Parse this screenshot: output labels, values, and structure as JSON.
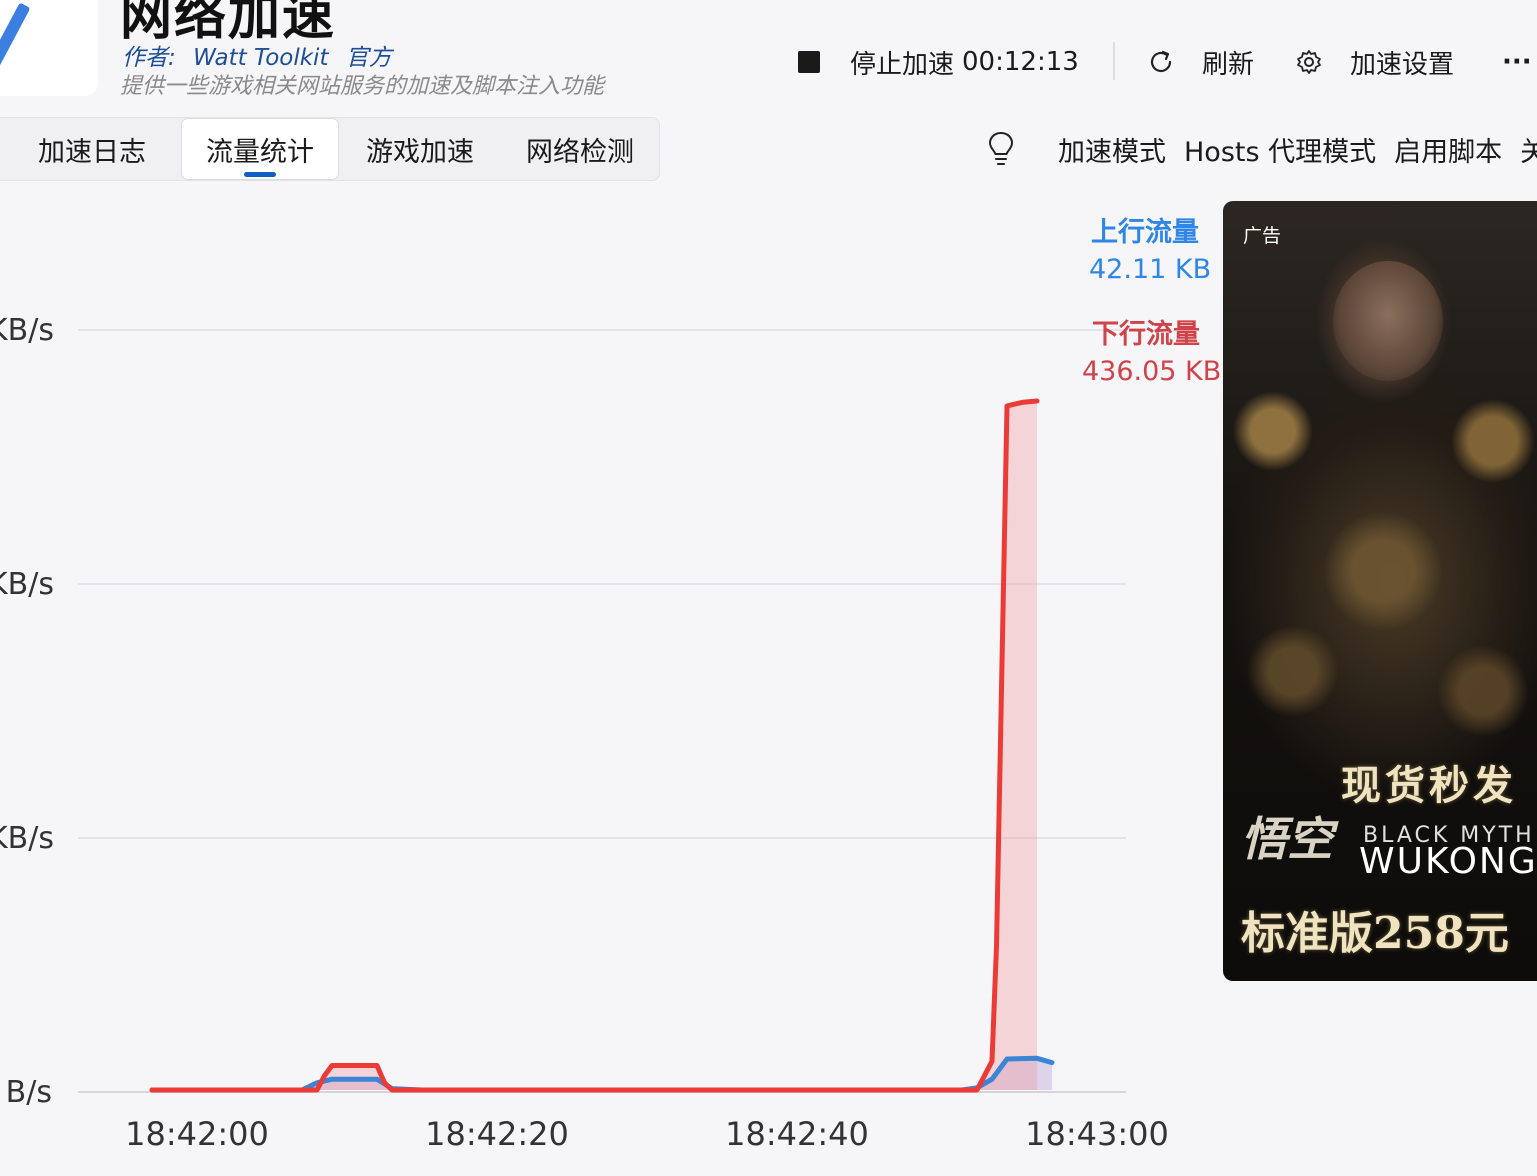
{
  "header": {
    "title": "网络加速",
    "author_label": "作者:",
    "author_name": "Watt Toolkit",
    "author_tag": "官方",
    "description": "提供一些游戏相关网站服务的加速及脚本注入功能"
  },
  "toolbar": {
    "stop_label": "停止加速",
    "timer": "00:12:13",
    "refresh_label": "刷新",
    "settings_label": "加速设置",
    "more_label": "···"
  },
  "tabs": [
    {
      "label": "加速日志",
      "active": false
    },
    {
      "label": "流量统计",
      "active": true
    },
    {
      "label": "游戏加速",
      "active": false
    },
    {
      "label": "网络检测",
      "active": false
    }
  ],
  "mode_bar": {
    "icon": "lightbulb-icon",
    "items": [
      "加速模式",
      "Hosts 代理模式",
      "启用脚本",
      "关"
    ]
  },
  "legend": {
    "upload_label": "上行流量",
    "upload_value": "42.11 KB",
    "upload_color": "#2f86e6",
    "download_label": "下行流量",
    "download_value": "436.05 KB",
    "download_color": "#d0434a"
  },
  "chart_data": {
    "type": "area",
    "y_ticks": [
      "KB/s",
      "KB/s",
      "KB/s",
      "B/s"
    ],
    "x_ticks": [
      "18:42:00",
      "18:42:20",
      "18:42:40",
      "18:43:00"
    ],
    "grid": true,
    "series": [
      {
        "name": "上行流量",
        "color": "#3a85d6",
        "points": [
          [
            -3,
            0
          ],
          [
            7,
            0
          ],
          [
            8,
            1
          ],
          [
            9,
            1.5
          ],
          [
            12,
            1.5
          ],
          [
            13,
            0.2
          ],
          [
            15,
            0
          ],
          [
            51,
            0
          ],
          [
            52,
            0.3
          ],
          [
            53,
            1.5
          ],
          [
            54,
            4.3
          ],
          [
            56,
            4.4
          ],
          [
            57,
            3.8
          ]
        ]
      },
      {
        "name": "下行流量",
        "color": "#ec3b36",
        "points": [
          [
            -3,
            0
          ],
          [
            8,
            0
          ],
          [
            8.5,
            2
          ],
          [
            9,
            3.4
          ],
          [
            12,
            3.4
          ],
          [
            12.5,
            1
          ],
          [
            13,
            0
          ],
          [
            52,
            0
          ],
          [
            53,
            4
          ],
          [
            53.3,
            20
          ],
          [
            54,
            95
          ],
          [
            55,
            95.5
          ],
          [
            56,
            95.7
          ]
        ]
      }
    ]
  },
  "ad": {
    "badge": "广告",
    "promo_line1": "现货秒发",
    "logo_cn": "悟空",
    "game_subtitle": "BLACK MYTH",
    "game_title": "WUKONG",
    "price_line": "标准版258元"
  }
}
